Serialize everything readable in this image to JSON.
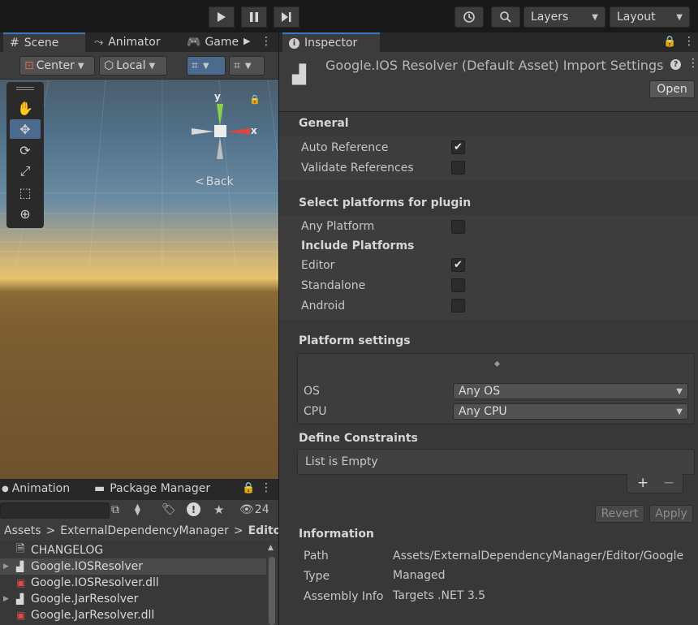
{
  "toolbar": {
    "play_icon": "play-icon",
    "pause_icon": "pause-icon",
    "step_icon": "step-icon",
    "layers_label": "Layers",
    "layout_label": "Layout"
  },
  "scene_panel": {
    "tabs": [
      "Scene",
      "Animator",
      "Game"
    ],
    "pivot_label": "Center",
    "space_label": "Local",
    "gizmo": {
      "y_label": "y",
      "x_label": "x",
      "back_label": "Back"
    }
  },
  "project_panel": {
    "tabs": [
      "Animation",
      "Package Manager"
    ],
    "hidden_count": "24",
    "breadcrumb": [
      "Assets",
      "ExternalDependencyManager",
      "Edito"
    ],
    "files": [
      {
        "name": "CHANGELOG",
        "icon": "text-file-icon"
      },
      {
        "name": "Google.IOSResolver",
        "icon": "plugin-icon"
      },
      {
        "name": "Google.IOSResolver.dll",
        "icon": "dll-icon"
      },
      {
        "name": "Google.JarResolver",
        "icon": "plugin-icon"
      },
      {
        "name": "Google.JarResolver.dll",
        "icon": "dll-icon"
      }
    ]
  },
  "inspector": {
    "tab_label": "Inspector",
    "title": "Google.IOS Resolver (Default Asset) Import Settings",
    "open_button": "Open",
    "general": {
      "heading": "General",
      "auto_reference": "Auto Reference",
      "auto_reference_checked": true,
      "validate_references": "Validate References",
      "validate_references_checked": false
    },
    "platforms": {
      "heading": "Select platforms for plugin",
      "any_platform": "Any Platform",
      "any_platform_checked": false,
      "include_heading": "Include Platforms",
      "editor": "Editor",
      "editor_checked": true,
      "standalone": "Standalone",
      "standalone_checked": false,
      "android": "Android",
      "android_checked": false
    },
    "platform_settings": {
      "heading": "Platform settings",
      "os_label": "OS",
      "os_value": "Any OS",
      "cpu_label": "CPU",
      "cpu_value": "Any CPU"
    },
    "define_constraints": {
      "heading": "Define Constraints",
      "empty_text": "List is Empty",
      "add_label": "+",
      "remove_label": "−"
    },
    "revert_button": "Revert",
    "apply_button": "Apply",
    "information": {
      "heading": "Information",
      "path_label": "Path",
      "path_value": "Assets/ExternalDependencyManager/Editor/Google",
      "type_label": "Type",
      "type_value": "Managed",
      "assembly_label": "Assembly Info",
      "assembly_value": "Targets .NET 3.5"
    }
  }
}
